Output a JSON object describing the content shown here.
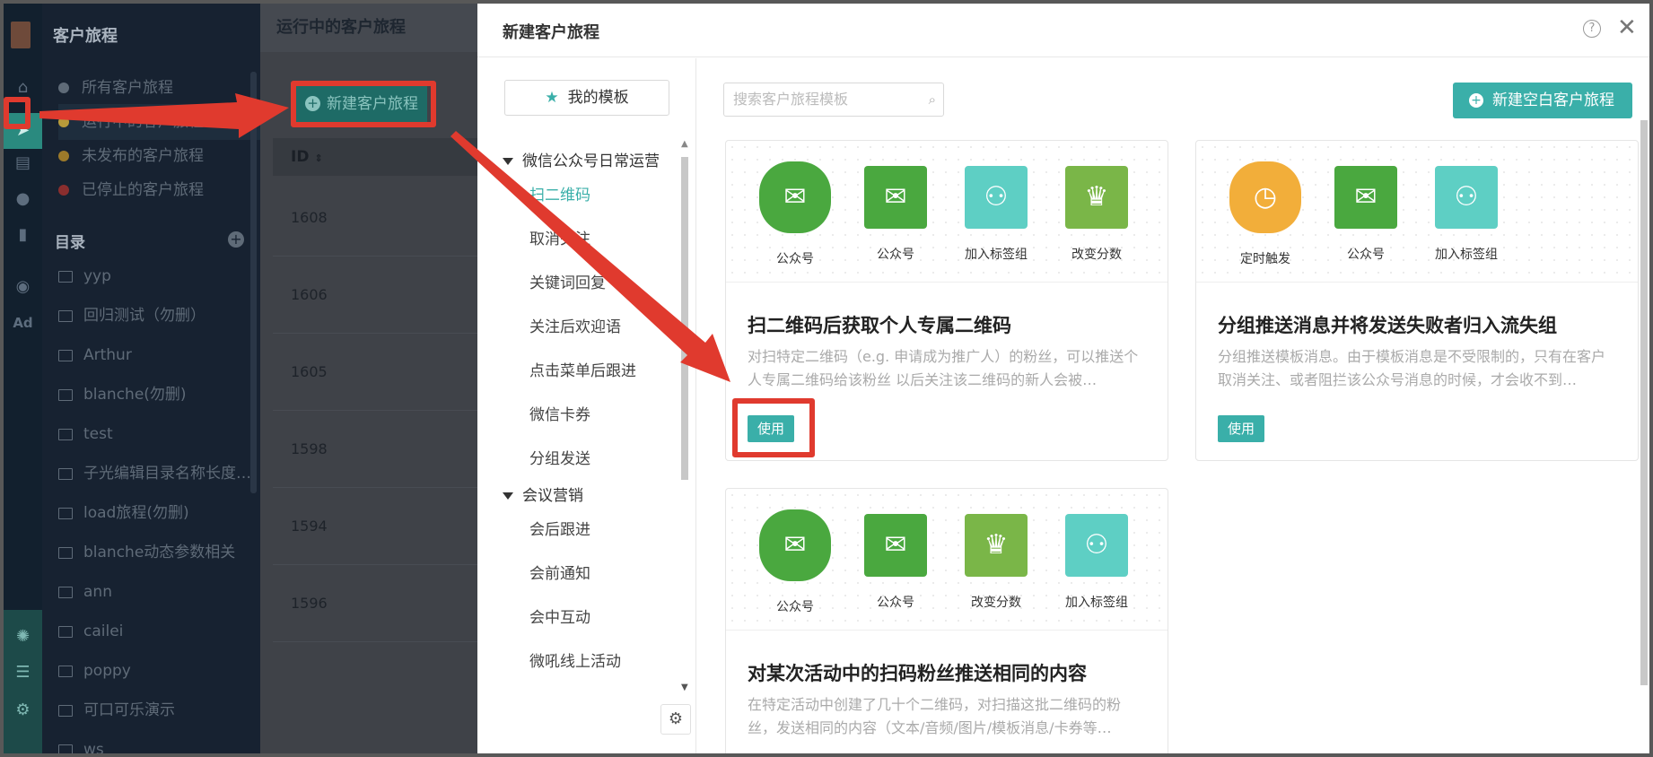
{
  "rail": {
    "icons": [
      "home-icon",
      "send-icon",
      "layout-icon",
      "user-icon",
      "bar-chart-icon",
      "wechat-icon",
      "ad-icon",
      "nodes-icon",
      "list-icon",
      "gear-icon"
    ],
    "ad_label": "Ad"
  },
  "sidebar": {
    "title": "客户旅程",
    "journeys": [
      {
        "label": "所有客户旅程",
        "color": "#5f6b78"
      },
      {
        "label": "运行中的客户旅程",
        "color": "#b89b3a"
      },
      {
        "label": "未发布的客户旅程",
        "color": "#9c7a2a"
      },
      {
        "label": "已停止的客户旅程",
        "color": "#8a2e2e"
      }
    ],
    "directory_label": "目录",
    "folders": [
      "yyp",
      "回归测试（勿删）",
      "Arthur",
      "blanche(勿删)",
      "test",
      "子光编辑目录名称长度…",
      "load旅程(勿删)",
      "blanche动态参数相关",
      "ann",
      "cailei",
      "poppy",
      "可口可乐演示",
      "ws"
    ]
  },
  "main": {
    "title": "运行中的客户旅程",
    "new_button": "新建客户旅程",
    "id_header": "ID",
    "ids": [
      "1608",
      "1606",
      "1605",
      "1598",
      "1594",
      "1596"
    ]
  },
  "modal": {
    "title": "新建客户旅程",
    "help": "?",
    "close": "✕",
    "my_templates": "我的模板",
    "groups": [
      {
        "label": "微信公众号日常运营",
        "items": [
          "扫二维码",
          "取消关注",
          "关键词回复",
          "关注后欢迎语",
          "点击菜单后跟进",
          "微信卡券",
          "分组发送"
        ]
      },
      {
        "label": "会议营销",
        "items": [
          "会后跟进",
          "会前通知",
          "会中互动",
          "微吼线上活动"
        ]
      }
    ],
    "active_item": "扫二维码",
    "search_placeholder": "搜索客户旅程模板",
    "new_blank": "新建空白客户旅程",
    "cards": [
      {
        "nodes": [
          {
            "label": "公众号",
            "icon": "wechat-icon",
            "color": "#4aa83f",
            "shape": "circle"
          },
          {
            "label": "公众号",
            "icon": "wechat-icon",
            "color": "#4aa83f",
            "shape": "square"
          },
          {
            "label": "加入标签组",
            "icon": "add-user-icon",
            "color": "#5ecfc4",
            "shape": "square"
          },
          {
            "label": "改变分数",
            "icon": "trophy-icon",
            "color": "#7ab648",
            "shape": "square"
          }
        ],
        "title": "扫二维码后获取个人专属二维码",
        "desc": "对扫特定二维码（e.g. 申请成为推广人）的粉丝，可以推送个人专属二维码给该粉丝 以后关注该二维码的新人会被…",
        "use": "使用"
      },
      {
        "nodes": [
          {
            "label": "定时触发",
            "icon": "clock-icon",
            "color": "#f2ae3a",
            "shape": "circle"
          },
          {
            "label": "公众号",
            "icon": "wechat-icon",
            "color": "#4aa83f",
            "shape": "square"
          },
          {
            "label": "加入标签组",
            "icon": "add-user-icon",
            "color": "#5ecfc4",
            "shape": "square"
          }
        ],
        "title": "分组推送消息并将发送失败者归入流失组",
        "desc": "分组推送模板消息。由于模板消息是不受限制的，只有在客户取消关注、或者阻拦该公众号消息的时候，才会收不到…",
        "use": "使用"
      },
      {
        "nodes": [
          {
            "label": "公众号",
            "icon": "wechat-icon",
            "color": "#4aa83f",
            "shape": "circle"
          },
          {
            "label": "公众号",
            "icon": "wechat-icon",
            "color": "#4aa83f",
            "shape": "square"
          },
          {
            "label": "改变分数",
            "icon": "trophy-icon",
            "color": "#7ab648",
            "shape": "square"
          },
          {
            "label": "加入标签组",
            "icon": "add-user-icon",
            "color": "#5ecfc4",
            "shape": "square"
          }
        ],
        "title": "对某次活动中的扫码粉丝推送相同的内容",
        "desc": "在特定活动中创建了几十个二维码，对扫描这批二维码的粉丝，发送相同的内容（文本/音频/图片/模板消息/卡券等…",
        "use": ""
      }
    ]
  }
}
